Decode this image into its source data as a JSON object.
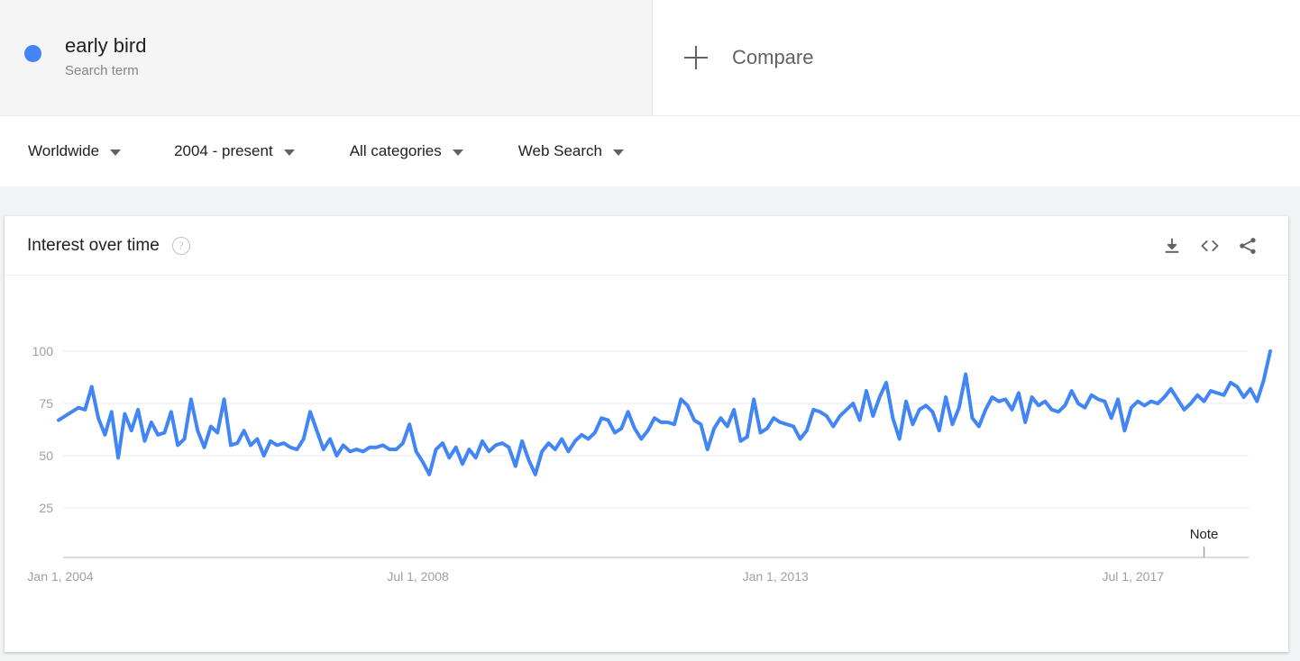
{
  "search_term": {
    "name": "early bird",
    "type_label": "Search term",
    "dot_color": "#4285f4"
  },
  "compare": {
    "label": "Compare",
    "icon": "plus-icon"
  },
  "filters": [
    {
      "label": "Worldwide",
      "icon": "chevron-down-icon"
    },
    {
      "label": "2004 - present",
      "icon": "chevron-down-icon"
    },
    {
      "label": "All categories",
      "icon": "chevron-down-icon"
    },
    {
      "label": "Web Search",
      "icon": "chevron-down-icon"
    }
  ],
  "chart_card": {
    "title": "Interest over time",
    "help_icon": "help-circle-icon",
    "actions": [
      {
        "name": "download-icon",
        "label": "Download"
      },
      {
        "name": "embed-code-icon",
        "label": "Embed"
      },
      {
        "name": "share-icon",
        "label": "Share"
      }
    ]
  },
  "chart_data": {
    "type": "line",
    "title": "Interest over time",
    "xlabel": "",
    "ylabel": "",
    "ylim": [
      0,
      100
    ],
    "yticks": [
      25,
      50,
      75,
      100
    ],
    "ytick_labels": [
      "25",
      "50",
      "75",
      "100"
    ],
    "xtick_labels": [
      "Jan 1, 2004",
      "Jul 1, 2008",
      "Jan 1, 2013",
      "Jul 1, 2017"
    ],
    "xtick_positions": [
      0,
      54,
      108,
      162
    ],
    "grid": true,
    "legend": false,
    "line_color": "#4285f4",
    "line_width": 4,
    "annotations": [
      {
        "label": "Note",
        "x_index": 173
      }
    ],
    "x_start": "2004-01",
    "x_end": "2019-07",
    "x_interval": "month",
    "series": [
      {
        "name": "early bird",
        "values": [
          67,
          69,
          71,
          73,
          72,
          83,
          68,
          60,
          71,
          49,
          70,
          62,
          72,
          57,
          66,
          60,
          61,
          71,
          55,
          58,
          77,
          62,
          54,
          64,
          61,
          77,
          55,
          56,
          62,
          55,
          58,
          50,
          57,
          55,
          56,
          54,
          53,
          58,
          71,
          62,
          53,
          58,
          50,
          55,
          52,
          53,
          52,
          54,
          54,
          55,
          53,
          53,
          56,
          65,
          52,
          47,
          41,
          53,
          56,
          49,
          54,
          46,
          53,
          49,
          57,
          52,
          55,
          56,
          54,
          45,
          57,
          48,
          41,
          52,
          56,
          53,
          58,
          52,
          57,
          60,
          58,
          61,
          68,
          67,
          61,
          63,
          71,
          63,
          58,
          62,
          68,
          66,
          66,
          65,
          77,
          74,
          67,
          65,
          53,
          63,
          68,
          64,
          72,
          57,
          59,
          77,
          61,
          63,
          68,
          66,
          65,
          64,
          58,
          62,
          72,
          71,
          69,
          64,
          69,
          72,
          75,
          67,
          81,
          69,
          78,
          85,
          68,
          58,
          76,
          65,
          72,
          74,
          71,
          62,
          78,
          65,
          73,
          89,
          68,
          64,
          72,
          78,
          76,
          77,
          72,
          80,
          66,
          78,
          74,
          76,
          72,
          71,
          74,
          81,
          75,
          73,
          79,
          77,
          76,
          68,
          77,
          62,
          73,
          76,
          74,
          76,
          75,
          78,
          82,
          77,
          72,
          75,
          79,
          76,
          81,
          80,
          79,
          85,
          83,
          78,
          82,
          76,
          86,
          100
        ]
      }
    ]
  }
}
